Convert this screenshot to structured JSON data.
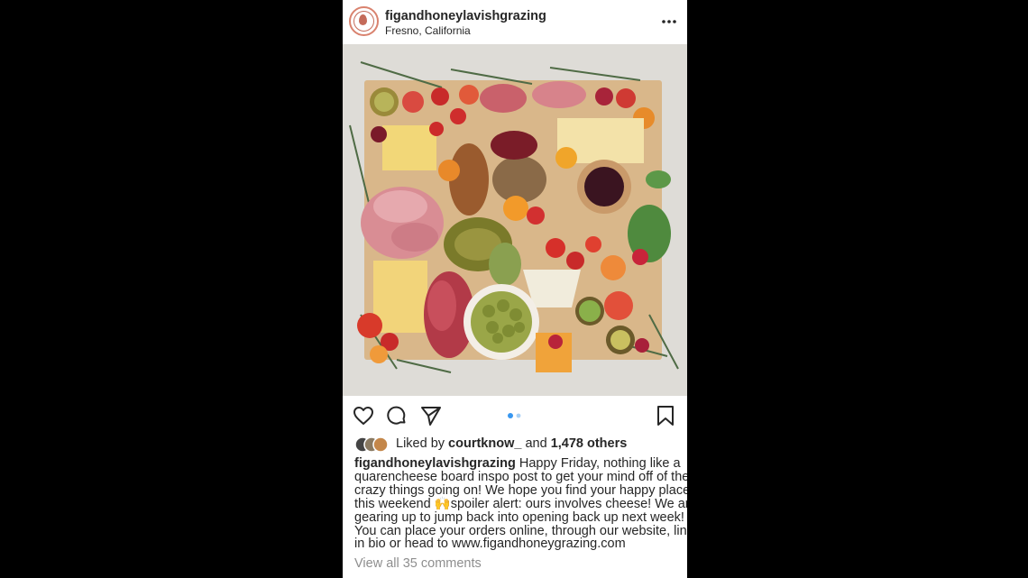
{
  "header": {
    "username": "figandhoneylavishgrazing",
    "location": "Fresno, California"
  },
  "photo": {
    "description_icon": "charcuterie-board-photo"
  },
  "actions": {
    "icons": [
      "heart-icon",
      "comment-icon",
      "share-icon",
      "bookmark-icon"
    ],
    "carousel": {
      "count": 2,
      "active": 0
    },
    "accent": "#3897f0"
  },
  "likes": {
    "prefix": "Liked by",
    "user": "courtknow_",
    "joiner": "and",
    "others": "1,478 others"
  },
  "caption": {
    "username": "figandhoneylavishgrazing",
    "line1": "Happy Friday, nothing like a",
    "line2": "quarencheese board inspo post to get your mind off of the",
    "line3": "crazy things going on! We hope you find your happy place",
    "line4a": "this weekend",
    "emoji": "🙌",
    "line4b": "spoiler alert: ours involves cheese! We are",
    "line5": "gearing up to jump back into opening back up next week!",
    "line6": "You can place your orders online, through our website, link",
    "line7": "in bio or head to www.figandhoneygrazing.com"
  },
  "comments": {
    "view_all": "View all 35 comments"
  }
}
